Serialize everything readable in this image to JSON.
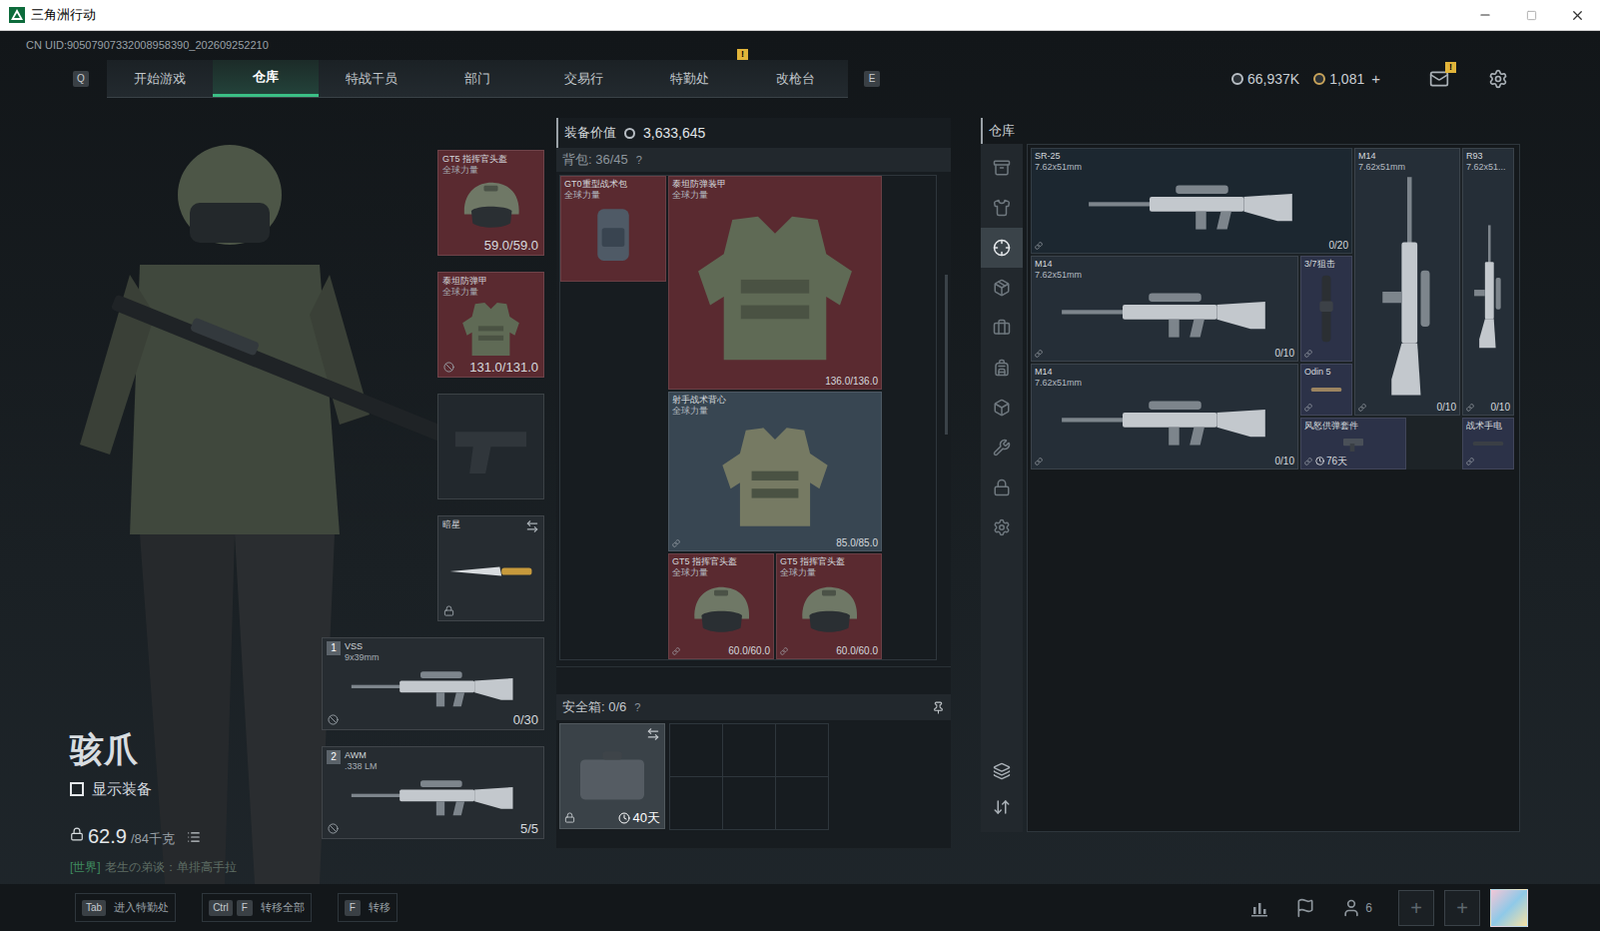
{
  "window": {
    "title": "三角洲行动"
  },
  "uid": "CN UID:90507907332008958390_202609252210",
  "nav": {
    "left_key": "Q",
    "right_key": "E",
    "tabs": [
      {
        "label": "开始游戏",
        "selected": false,
        "badge": ""
      },
      {
        "label": "仓库",
        "selected": true,
        "badge": ""
      },
      {
        "label": "特战干员",
        "selected": false,
        "badge": ""
      },
      {
        "label": "部门",
        "selected": false,
        "badge": ""
      },
      {
        "label": "交易行",
        "selected": false,
        "badge": ""
      },
      {
        "label": "特勤处",
        "selected": false,
        "badge": "!"
      },
      {
        "label": "改枪台",
        "selected": false,
        "badge": ""
      }
    ]
  },
  "currency": [
    {
      "amount": "66,937K",
      "color": "#b8bec4",
      "add": ""
    },
    {
      "amount": "1,081",
      "color": "#c9a45a",
      "add": "+"
    }
  ],
  "mail": {
    "badge": "!"
  },
  "operator": {
    "name": "骇爪",
    "show_equipment": {
      "label": "显示装备",
      "checked": false
    },
    "weight": "62.9",
    "capacity": "/84千克",
    "chat": {
      "channel": "[世界]",
      "text": "老生の弟谈：单排高手拉"
    }
  },
  "equipment": [
    {
      "kind": "helmet",
      "name": "GT5 指挥官头盔",
      "sub": "全球力量",
      "value": "59.0/59.0",
      "color": "#5a2a30",
      "bound": false,
      "locked": false,
      "swappable": false
    },
    {
      "kind": "armor",
      "name": "泰坦防弹甲",
      "sub": "全球力量",
      "value": "131.0/131.0",
      "color": "#5a2a30",
      "bound": true,
      "locked": false,
      "swappable": false
    },
    {
      "kind": "pistol",
      "name": "",
      "sub": "",
      "value": "",
      "color": "#22282d",
      "bound": false,
      "locked": false,
      "swappable": false
    },
    {
      "kind": "knife",
      "name": "暗星",
      "sub": "",
      "value": "",
      "color": "#262c31",
      "bound": false,
      "locked": true,
      "swappable": true
    },
    {
      "kind": "weapon",
      "index": "1",
      "name": "VSS",
      "sub": "9x39mm",
      "value": "0/30",
      "color": "#262c31",
      "bound": true,
      "locked": false,
      "swappable": false
    },
    {
      "kind": "weapon",
      "index": "2",
      "name": "AWM",
      "sub": ".338 LM",
      "value": "5/5",
      "color": "#262c31",
      "bound": true,
      "locked": false,
      "swappable": false
    }
  ],
  "loadout": {
    "value_label": "装备价值",
    "value": "3,633,645",
    "backpack": {
      "label": "背包: 36/45",
      "help": "?"
    },
    "items": [
      {
        "kind": "bag",
        "name": "GT0重型战术包",
        "sub": "全球力量",
        "value": "",
        "color": "#5a2a30",
        "bound": false
      },
      {
        "kind": "armor",
        "name": "泰坦防弹装甲",
        "sub": "全球力量",
        "value": "136.0/136.0",
        "color": "#5a2a30",
        "bound": false
      },
      {
        "kind": "vest",
        "name": "射手战术背心",
        "sub": "全球力量",
        "value": "85.0/85.0",
        "color": "#384652",
        "bound": true
      },
      {
        "kind": "helmet",
        "name": "GT5 指挥官头盔",
        "sub": "全球力量",
        "value": "60.0/60.0",
        "color": "#5a2a30",
        "bound": true
      },
      {
        "kind": "helmet",
        "name": "GT5 指挥官头盔",
        "sub": "全球力量",
        "value": "60.0/60.0",
        "color": "#5a2a30",
        "bound": true
      }
    ],
    "safebox": {
      "label": "安全箱: 0/6",
      "help": "?",
      "time": "40天",
      "locked": true,
      "swappable": true
    }
  },
  "warehouse": {
    "title": "仓库",
    "sidebar": [
      {
        "selected": false
      },
      {
        "selected": false
      },
      {
        "selected": true
      },
      {
        "selected": false
      },
      {
        "selected": false
      },
      {
        "selected": false
      },
      {
        "selected": false
      },
      {
        "selected": false
      },
      {
        "selected": false
      },
      {
        "selected": false
      }
    ],
    "items": [
      {
        "kind": "rifle",
        "name": "SR-25",
        "sub": "7.62x51mm",
        "value": "0/20",
        "time": "",
        "color": "#1c2730",
        "bound": true
      },
      {
        "kind": "rifle_v",
        "name": "M14",
        "sub": "7.62x51mm",
        "value": "0/10",
        "time": "",
        "color": "#252e37",
        "bound": true
      },
      {
        "kind": "rifle_v",
        "name": "R93",
        "sub": "7.62x51...",
        "value": "0/10",
        "time": "",
        "color": "#252e37",
        "bound": true
      },
      {
        "kind": "rifle",
        "name": "M14",
        "sub": "7.62x51mm",
        "value": "0/10",
        "time": "",
        "color": "#252e37",
        "bound": true
      },
      {
        "kind": "scope",
        "name": "3/7狙击",
        "sub": "",
        "value": "",
        "time": "",
        "color": "#2c3248",
        "bound": true
      },
      {
        "kind": "rifle",
        "name": "M14",
        "sub": "7.62x51mm",
        "value": "0/10",
        "time": "",
        "color": "#252e37",
        "bound": true
      },
      {
        "kind": "part",
        "name": "Odin 5",
        "sub": "",
        "value": "",
        "time": "",
        "color": "#2c3248",
        "bound": true
      },
      {
        "kind": "kit",
        "name": "风怒供弹套件",
        "sub": "",
        "value": "",
        "time": "76天",
        "color": "#2c3248",
        "bound": true
      },
      {
        "kind": "light",
        "name": "战术手电",
        "sub": "",
        "value": "",
        "time": "",
        "color": "#2c3248",
        "bound": true
      }
    ]
  },
  "hints": [
    {
      "keys": [
        "Tab"
      ],
      "label": "进入特勤处"
    },
    {
      "keys": [
        "Ctrl",
        "F"
      ],
      "label": "转移全部"
    },
    {
      "keys": [
        "F"
      ],
      "label": "转移"
    }
  ],
  "social": {
    "friends": "6",
    "slots": [
      "+",
      "+"
    ]
  }
}
